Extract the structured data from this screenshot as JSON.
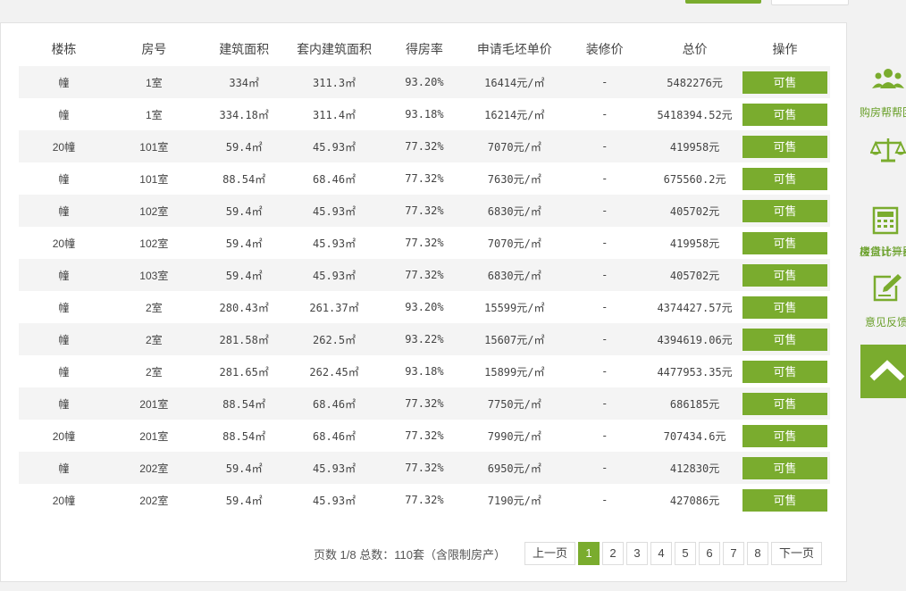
{
  "table": {
    "headers": [
      "楼栋",
      "房号",
      "建筑面积",
      "套内建筑面积",
      "得房率",
      "申请毛坯单价",
      "装修价",
      "总价",
      "操作"
    ],
    "rows": [
      [
        "幢",
        "1室",
        "334㎡",
        "311.3㎡",
        "93.20%",
        "16414元/㎡",
        "-",
        "5482276元",
        "可售"
      ],
      [
        "幢",
        "1室",
        "334.18㎡",
        "311.4㎡",
        "93.18%",
        "16214元/㎡",
        "-",
        "5418394.52元",
        "可售"
      ],
      [
        "20幢",
        "101室",
        "59.4㎡",
        "45.93㎡",
        "77.32%",
        "7070元/㎡",
        "-",
        "419958元",
        "可售"
      ],
      [
        "幢",
        "101室",
        "88.54㎡",
        "68.46㎡",
        "77.32%",
        "7630元/㎡",
        "-",
        "675560.2元",
        "可售"
      ],
      [
        "幢",
        "102室",
        "59.4㎡",
        "45.93㎡",
        "77.32%",
        "6830元/㎡",
        "-",
        "405702元",
        "可售"
      ],
      [
        "20幢",
        "102室",
        "59.4㎡",
        "45.93㎡",
        "77.32%",
        "7070元/㎡",
        "-",
        "419958元",
        "可售"
      ],
      [
        "幢",
        "103室",
        "59.4㎡",
        "45.93㎡",
        "77.32%",
        "6830元/㎡",
        "-",
        "405702元",
        "可售"
      ],
      [
        "幢",
        "2室",
        "280.43㎡",
        "261.37㎡",
        "93.20%",
        "15599元/㎡",
        "-",
        "4374427.57元",
        "可售"
      ],
      [
        "幢",
        "2室",
        "281.58㎡",
        "262.5㎡",
        "93.22%",
        "15607元/㎡",
        "-",
        "4394619.06元",
        "可售"
      ],
      [
        "幢",
        "2室",
        "281.65㎡",
        "262.45㎡",
        "93.18%",
        "15899元/㎡",
        "-",
        "4477953.35元",
        "可售"
      ],
      [
        "幢",
        "201室",
        "88.54㎡",
        "68.46㎡",
        "77.32%",
        "7750元/㎡",
        "-",
        "686185元",
        "可售"
      ],
      [
        "20幢",
        "201室",
        "88.54㎡",
        "68.46㎡",
        "77.32%",
        "7990元/㎡",
        "-",
        "707434.6元",
        "可售"
      ],
      [
        "幢",
        "202室",
        "59.4㎡",
        "45.93㎡",
        "77.32%",
        "6950元/㎡",
        "-",
        "412830元",
        "可售"
      ],
      [
        "20幢",
        "202室",
        "59.4㎡",
        "45.93㎡",
        "77.32%",
        "7190元/㎡",
        "-",
        "427086元",
        "可售"
      ]
    ]
  },
  "pagination": {
    "info": "页数 1/8 总数：110套（含限制房产）",
    "prev": "上一页",
    "next": "下一页",
    "pages": [
      "1",
      "2",
      "3",
      "4",
      "5",
      "6",
      "7",
      "8"
    ],
    "current": "1"
  },
  "sidebar": {
    "items": [
      {
        "label": "购房帮帮团",
        "icon": "group-icon"
      },
      {
        "label": "楼盘比一比",
        "icon": "scale-icon"
      },
      {
        "label": "房贷计算器",
        "icon": "calculator-icon"
      },
      {
        "label": "意见反馈",
        "icon": "edit-icon"
      }
    ],
    "top_icon": "arrow-up-icon"
  },
  "colors": {
    "accent": "#7aac2e",
    "row_stripe": "#f4f4f4"
  }
}
